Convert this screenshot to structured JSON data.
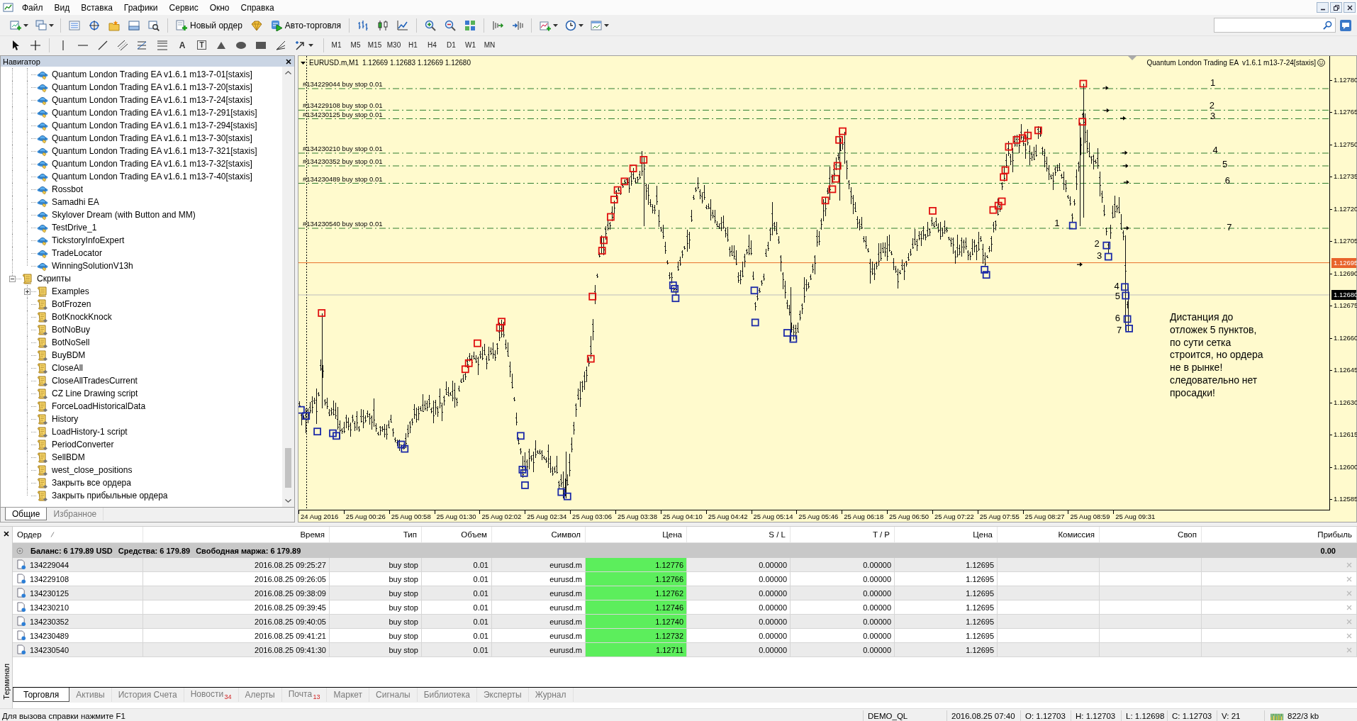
{
  "menu": [
    "Файл",
    "Вид",
    "Вставка",
    "Графики",
    "Сервис",
    "Окно",
    "Справка"
  ],
  "toolbar": {
    "new_order": "Новый ордер",
    "auto_trading": "Авто-торговля",
    "text_tool": "A",
    "label_tool": "T",
    "timeframes": [
      "M1",
      "M5",
      "M15",
      "M30",
      "H1",
      "H4",
      "D1",
      "W1",
      "MN"
    ]
  },
  "navigator": {
    "title": "Навигатор",
    "tree": [
      {
        "children": [
          {
            "label": "Quantum London Trading EA v1.6.1 m13-7-01[staxis]",
            "kind": "expert"
          },
          {
            "label": "Quantum London Trading EA v1.6.1 m13-7-20[staxis]",
            "kind": "expert"
          },
          {
            "label": "Quantum London Trading EA v1.6.1 m13-7-24[staxis]",
            "kind": "expert"
          },
          {
            "label": "Quantum London Trading EA v1.6.1 m13-7-291[staxis]",
            "kind": "expert"
          },
          {
            "label": "Quantum London Trading EA v1.6.1 m13-7-294[staxis]",
            "kind": "expert"
          },
          {
            "label": "Quantum London Trading EA v1.6.1 m13-7-30[staxis]",
            "kind": "expert"
          },
          {
            "label": "Quantum London Trading EA v1.6.1 m13-7-321[staxis]",
            "kind": "expert"
          },
          {
            "label": "Quantum London Trading EA v1.6.1 m13-7-32[staxis]",
            "kind": "expert"
          },
          {
            "label": "Quantum London Trading EA v1.6.1 m13-7-40[staxis]",
            "kind": "expert"
          },
          {
            "label": "Rossbot",
            "kind": "expert"
          },
          {
            "label": "Samadhi EA",
            "kind": "expert"
          },
          {
            "label": "Skylover Dream (with Button and MM)",
            "kind": "expert"
          },
          {
            "label": "TestDrive_1",
            "kind": "expert"
          },
          {
            "label": "TickstoryInfoExpert",
            "kind": "expert"
          },
          {
            "label": "TradeLocator",
            "kind": "expert"
          },
          {
            "label": "WinningSolutionV13h",
            "kind": "expert"
          }
        ]
      },
      {
        "label": "Скрипты",
        "kind": "folder",
        "expanded": true,
        "children": [
          {
            "label": "Examples",
            "kind": "folder",
            "expanded": false
          },
          {
            "label": "BotFrozen",
            "kind": "script"
          },
          {
            "label": "BotKnockKnock",
            "kind": "script"
          },
          {
            "label": "BotNoBuy",
            "kind": "script"
          },
          {
            "label": "BotNoSell",
            "kind": "script"
          },
          {
            "label": "BuyBDM",
            "kind": "script"
          },
          {
            "label": "CloseAll",
            "kind": "script"
          },
          {
            "label": "CloseAllTradesCurrent",
            "kind": "script"
          },
          {
            "label": "CZ Line Drawing script",
            "kind": "script"
          },
          {
            "label": "ForceLoadHistoricalData",
            "kind": "script"
          },
          {
            "label": "History",
            "kind": "script"
          },
          {
            "label": "LoadHistory-1 script",
            "kind": "script"
          },
          {
            "label": "PeriodConverter",
            "kind": "script"
          },
          {
            "label": "SellBDM",
            "kind": "script"
          },
          {
            "label": "west_close_positions",
            "kind": "script"
          },
          {
            "label": "Закрыть все ордера",
            "kind": "script"
          },
          {
            "label": "Закрыть прибыльные ордера",
            "kind": "script"
          }
        ]
      }
    ],
    "tabs": [
      {
        "label": "Общие",
        "selected": true
      },
      {
        "label": "Избранное",
        "selected": false
      }
    ]
  },
  "chart": {
    "symbol": "EURUSD.m,M1",
    "ohlc": "1.12669 1.12683 1.12669 1.12680",
    "expert": "Quantum London Trading EA  v1.6.1 m13-7-24[staxis]",
    "order_lines": [
      {
        "label": "#134229044 buy stop 0.01",
        "number": "1"
      },
      {
        "label": "#134229108 buy stop 0.01",
        "number": "2"
      },
      {
        "label": "#134230125 buy stop 0.01",
        "number": "3"
      },
      {
        "label": "#134230210 buy stop 0.01",
        "number": "4"
      },
      {
        "label": "#134230352 buy stop 0.01",
        "number": "5"
      },
      {
        "label": "#134230489 buy stop 0.01",
        "number": "6"
      },
      {
        "label": "#134230540 buy stop 0.01",
        "number": "7"
      }
    ],
    "marker_labels": [
      "1",
      "2",
      "3",
      "4",
      "5",
      "6",
      "7"
    ],
    "note": [
      "Дистанция до",
      "отложек 5 пунктов,",
      "по сути сетка",
      "строится, но ордера",
      "не в рынке!",
      "следовательно нет",
      "просадки!"
    ],
    "bid_tag": "1.12695",
    "last_tag": "1.12680",
    "price_axis": [
      "1.12780",
      "1.12765",
      "1.12750",
      "1.12735",
      "1.12720",
      "1.12705",
      "1.12690",
      "1.12675",
      "1.12660",
      "1.12645",
      "1.12630",
      "1.12615",
      "1.12600",
      "1.12585"
    ],
    "time_axis": [
      "24 Aug 2016",
      "25 Aug 00:26",
      "25 Aug 00:58",
      "25 Aug 01:30",
      "25 Aug 02:02",
      "25 Aug 02:34",
      "25 Aug 03:06",
      "25 Aug 03:38",
      "25 Aug 04:10",
      "25 Aug 04:42",
      "25 Aug 05:14",
      "25 Aug 05:46",
      "25 Aug 06:18",
      "25 Aug 06:50",
      "25 Aug 07:22",
      "25 Aug 07:55",
      "25 Aug 08:27",
      "25 Aug 08:59",
      "25 Aug 09:31"
    ]
  },
  "terminal": {
    "title": "Терминал",
    "columns": [
      {
        "label": "Ордер",
        "sorted": true
      },
      {
        "label": "Время",
        "sorted": false
      },
      {
        "label": "Тип",
        "sorted": false
      },
      {
        "label": "Объем",
        "sorted": false
      },
      {
        "label": "Символ",
        "sorted": false
      },
      {
        "label": "Цена",
        "sorted": false
      },
      {
        "label": "S / L",
        "sorted": false
      },
      {
        "label": "T / P",
        "sorted": false
      },
      {
        "label": "Цена",
        "sorted": false
      },
      {
        "label": "Комиссия",
        "sorted": false
      },
      {
        "label": "Своп",
        "sorted": false
      },
      {
        "label": "Прибыль",
        "sorted": false
      }
    ],
    "summary": {
      "balance": "Баланс: 6 179.89 USD",
      "equity": "Средства: 6 179.89",
      "free_margin": "Свободная маржа: 6 179.89",
      "profit": "0.00"
    },
    "rows": [
      {
        "order": "134229044",
        "time": "2016.08.25 09:25:27",
        "type": "buy stop",
        "volume": "0.01",
        "symbol": "eurusd.m",
        "price": "1.12776",
        "sl": "0.00000",
        "tp": "0.00000",
        "market_price": "1.12695"
      },
      {
        "order": "134229108",
        "time": "2016.08.25 09:26:05",
        "type": "buy stop",
        "volume": "0.01",
        "symbol": "eurusd.m",
        "price": "1.12766",
        "sl": "0.00000",
        "tp": "0.00000",
        "market_price": "1.12695"
      },
      {
        "order": "134230125",
        "time": "2016.08.25 09:38:09",
        "type": "buy stop",
        "volume": "0.01",
        "symbol": "eurusd.m",
        "price": "1.12762",
        "sl": "0.00000",
        "tp": "0.00000",
        "market_price": "1.12695"
      },
      {
        "order": "134230210",
        "time": "2016.08.25 09:39:45",
        "type": "buy stop",
        "volume": "0.01",
        "symbol": "eurusd.m",
        "price": "1.12746",
        "sl": "0.00000",
        "tp": "0.00000",
        "market_price": "1.12695"
      },
      {
        "order": "134230352",
        "time": "2016.08.25 09:40:05",
        "type": "buy stop",
        "volume": "0.01",
        "symbol": "eurusd.m",
        "price": "1.12740",
        "sl": "0.00000",
        "tp": "0.00000",
        "market_price": "1.12695"
      },
      {
        "order": "134230489",
        "time": "2016.08.25 09:41:21",
        "type": "buy stop",
        "volume": "0.01",
        "symbol": "eurusd.m",
        "price": "1.12732",
        "sl": "0.00000",
        "tp": "0.00000",
        "market_price": "1.12695"
      },
      {
        "order": "134230540",
        "time": "2016.08.25 09:41:30",
        "type": "buy stop",
        "volume": "0.01",
        "symbol": "eurusd.m",
        "price": "1.12711",
        "sl": "0.00000",
        "tp": "0.00000",
        "market_price": "1.12695"
      }
    ],
    "tabs": [
      {
        "label": "Торговля",
        "selected": true
      },
      {
        "label": "Активы",
        "selected": false
      },
      {
        "label": "История Счета",
        "selected": false
      },
      {
        "label": "Новости",
        "selected": false,
        "badge": "34"
      },
      {
        "label": "Алерты",
        "selected": false
      },
      {
        "label": "Почта",
        "selected": false,
        "badge": "13"
      },
      {
        "label": "Маркет",
        "selected": false
      },
      {
        "label": "Сигналы",
        "selected": false
      },
      {
        "label": "Библиотека",
        "selected": false
      },
      {
        "label": "Эксперты",
        "selected": false
      },
      {
        "label": "Журнал",
        "selected": false
      }
    ]
  },
  "status_bar": {
    "hint": "Для вызова справки нажмите F1",
    "profile": "DEMO_QL",
    "datetime": "2016.08.25 07:40",
    "open": "O: 1.12703",
    "high": "H: 1.12703",
    "low": "L: 1.12698",
    "close": "C: 1.12703",
    "volume": "V: 21",
    "traffic": "822/3 kb"
  }
}
